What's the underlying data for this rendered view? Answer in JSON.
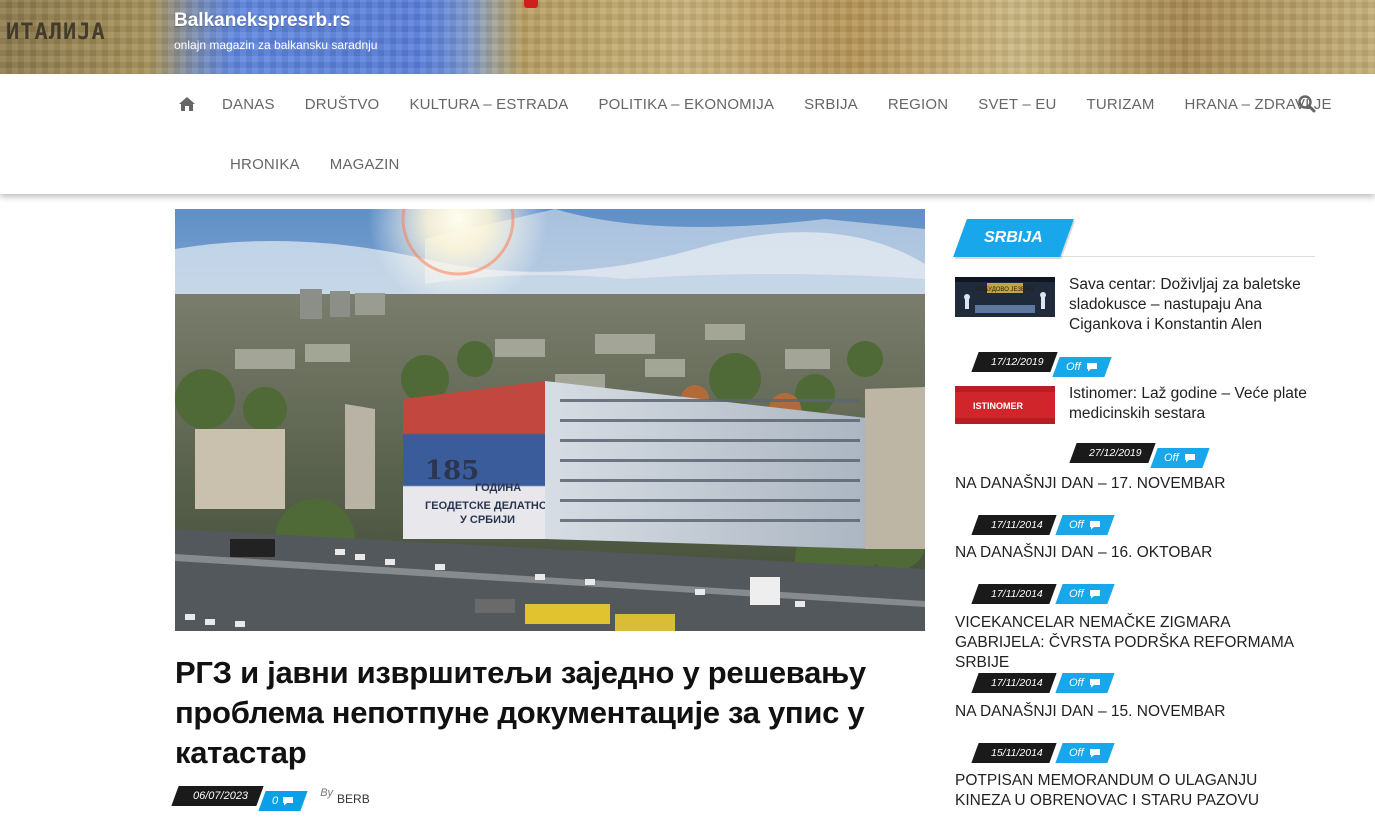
{
  "site": {
    "title": "Balkanekspresrb.rs",
    "tagline": "onlajn magazin za balkansku saradnju",
    "banner_overlay_text": "ИТАЛИЈА"
  },
  "nav": {
    "home_icon": "home-icon",
    "search_icon": "search-icon",
    "row1": [
      "DANAS",
      "DRUŠTVO",
      "KULTURA – ESTRADA",
      "POLITIKA – EKONOMIJA",
      "SRBIJA",
      "REGION",
      "SVET – EU",
      "TURIZAM",
      "HRANA – ZDRAVLJE"
    ],
    "row2": [
      "HRONIKA",
      "MAGAZIN"
    ]
  },
  "feature": {
    "image_text_number": "185",
    "image_text_line1": "ГОДИНА",
    "image_text_line2": "ГЕОДЕТСКЕ ДЕЛАТНОСТИ",
    "image_text_line3": "У СРБИЈИ",
    "title": "РГЗ и јавни извршитељи заједно у решевању проблема непотпуне документације за упис у катастар",
    "date": "06/07/2023",
    "comments": "0",
    "by_label": "By",
    "author": "BERB"
  },
  "sidebar": {
    "widget_title": "SRBIJA",
    "posts": [
      {
        "title": "Sava centar: Doživljaj za baletske sladokusce – nastupaju Ana Cigankova i Konstantin Alen",
        "date": "17/12/2019",
        "comments": "Off",
        "thumb_text": "ЛАБУДОВО ЈЕЗЕРО"
      },
      {
        "title": "Istinomer: Laž godine – Veće plate medicinskih sestara",
        "date": "27/12/2019",
        "comments": "Off",
        "thumb_text": "ISTINOMER"
      }
    ],
    "text_posts": [
      {
        "title": "NA DANAŠNJI DAN – 17. NOVEMBAR",
        "date": "17/11/2014",
        "comments": "Off"
      },
      {
        "title": "NA DANAŠNJI DAN – 16. OKTOBAR",
        "date": "17/11/2014",
        "comments": "Off"
      },
      {
        "title": "VICEKANCELAR NEMAČKE ZIGMARA GABRIJELA: ČVRSTA PODRŠKA REFORMAMA SRBIJE",
        "date": "17/11/2014",
        "comments": "Off"
      },
      {
        "title": "NA DANAŠNJI DAN – 15. NOVEMBAR",
        "date": "15/11/2014",
        "comments": "Off"
      },
      {
        "title": "POTPISAN MEMORANDUM O ULAGANJU KINEZA U OBRENOVAC I STARU PAZOVU",
        "date": "",
        "comments": ""
      }
    ]
  },
  "colors": {
    "accent": "#17a7ea",
    "date_badge": "#1a1a1a",
    "nav_text": "#666666"
  }
}
